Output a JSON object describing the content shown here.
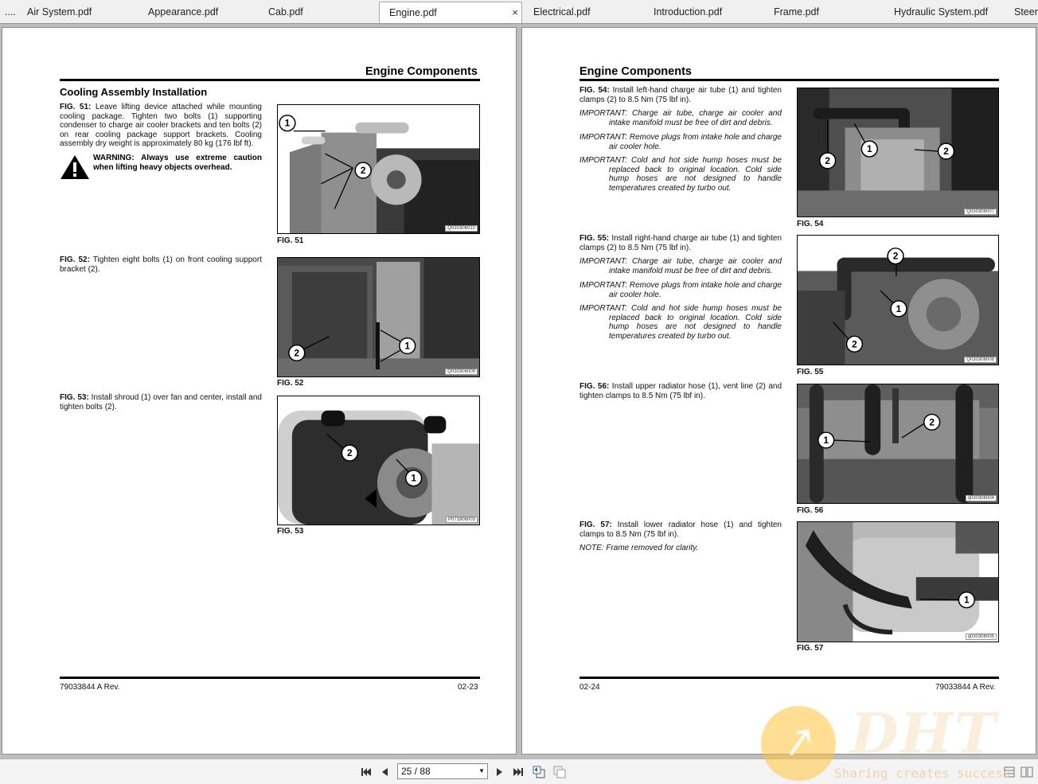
{
  "tabs": [
    {
      "label": "....",
      "active": false
    },
    {
      "label": "Air System.pdf",
      "active": false
    },
    {
      "label": "Appearance.pdf",
      "active": false
    },
    {
      "label": "Cab.pdf",
      "active": false
    },
    {
      "label": "Engine.pdf",
      "active": true,
      "close": "×"
    },
    {
      "label": "Electrical.pdf",
      "active": false
    },
    {
      "label": "Introduction.pdf",
      "active": false
    },
    {
      "label": "Frame.pdf",
      "active": false
    },
    {
      "label": "Hydraulic System.pdf",
      "active": false
    },
    {
      "label": "Steer",
      "active": false
    }
  ],
  "left_page": {
    "header": "Engine Components",
    "section": "Cooling Assembly Installation",
    "fig51": {
      "label": "FIG. 51:",
      "text": "Leave lifting device attached while mounting cooling package. Tighten two bolts (1) supporting condenser to charge air cooler brackets and ten bolts (2) on rear cooling package support brackets. Cooling assembly dry weight is approximately 80 kg (176 lbf ft).",
      "warning": "WARNING: Always use extreme caution when lifting heavy objects overhead.",
      "caption": "FIG. 51",
      "code": "Q030306010"
    },
    "fig52": {
      "label": "FIG. 52:",
      "text": "Tighten eight bolts (1) on front cooling support bracket (2).",
      "caption": "FIG. 52",
      "code": "Q030306009"
    },
    "fig53": {
      "label": "FIG. 53:",
      "text": "Install shroud (1) over fan and center, install and tighten bolts (2).",
      "caption": "FIG. 53",
      "code": "P071806003"
    },
    "footer_left": "79033844 A Rev.",
    "footer_right": "02-23"
  },
  "right_page": {
    "header": "Engine Components",
    "fig54": {
      "label": "FIG. 54:",
      "text": "Install left-hand charge air tube (1) and tighten clamps (2) to 8.5 Nm (75 lbf in).",
      "important1": "IMPORTANT: Charge air tube, charge air cooler and intake manifold must be free of dirt and debris.",
      "important2": "IMPORTANT: Remove plugs from intake hole and charge air cooler hole.",
      "important3": "IMPORTANT: Cold and hot side hump hoses must be replaced back to original location. Cold side hump hoses are not designed to handle temperatures created by turbo out.",
      "caption": "FIG. 54",
      "code": "Q030306007"
    },
    "fig55": {
      "label": "FIG. 55:",
      "text": "Install right-hand charge air tube (1) and tighten clamps (2) to 8.5 Nm (75 lbf in).",
      "important1": "IMPORTANT: Charge air tube, charge air cooler and intake manifold must be free of dirt and debris.",
      "important2": "IMPORTANT: Remove plugs from intake hole and charge air cooler hole.",
      "important3": "IMPORTANT: Cold and hot side hump hoses must be replaced back to original location. Cold side hump hoses are not designed to handle temperatures created by turbo out.",
      "caption": "FIG. 55",
      "code": "Q030306008"
    },
    "fig56": {
      "label": "FIG. 56:",
      "text": "Install upper radiator hose (1), vent line (2) and tighten clamps to 8.5 Nm (75 lbf in).",
      "caption": "FIG. 56",
      "code": "q030306004"
    },
    "fig57": {
      "label": "FIG. 57:",
      "text": "Install lower radiator hose (1) and tighten clamps to 8.5 Nm (75 lbf in).",
      "note": "NOTE: Frame removed for clarity.",
      "caption": "FIG. 57",
      "code": "q030306005"
    },
    "footer_left": "02-24",
    "footer_right": "79033844 A Rev."
  },
  "toolbar": {
    "page_indicator": "25 / 88"
  },
  "watermark": {
    "logo_text": "DHT",
    "tagline": "Sharing creates success"
  },
  "colors": {
    "tab_bar": "#f0f0f0",
    "viewer_bg": "#bdbdbd",
    "watermark": "#ffc43c"
  }
}
